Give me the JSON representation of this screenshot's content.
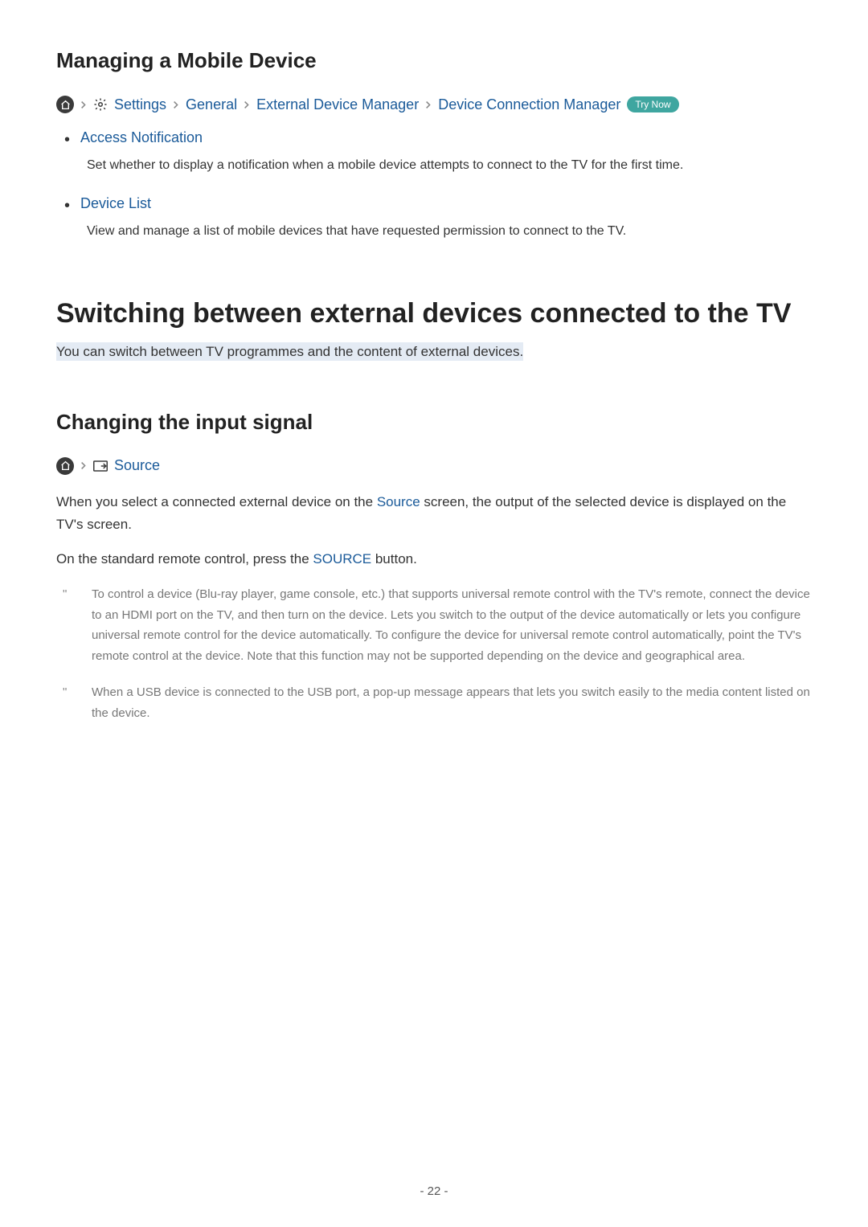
{
  "section1": {
    "title": "Managing a Mobile Device",
    "breadcrumb": {
      "settings": "Settings",
      "general": "General",
      "edm": "External Device Manager",
      "dcm": "Device Connection Manager",
      "tryNow": "Try Now"
    },
    "bullets": [
      {
        "title": "Access Notification",
        "desc": "Set whether to display a notification when a mobile device attempts to connect to the TV for the first time."
      },
      {
        "title": "Device List",
        "desc": "View and manage a list of mobile devices that have requested permission to connect to the TV."
      }
    ]
  },
  "main": {
    "title": "Switching between external devices connected to the TV",
    "intro": "You can switch between TV programmes and the content of external devices."
  },
  "section2": {
    "title": "Changing the input signal",
    "breadcrumb": {
      "source": "Source"
    },
    "p1a": "When you select a connected external device on the ",
    "p1link": "Source",
    "p1b": " screen, the output of the selected device is displayed on the TV's screen.",
    "p2a": "On the standard remote control, press the ",
    "p2link": "SOURCE",
    "p2b": " button.",
    "notes": [
      "To control a device (Blu-ray player, game console, etc.) that supports universal remote control with the TV's remote, connect the device to an HDMI port on the TV, and then turn on the device. Lets you switch to the output of the device automatically or lets you configure universal remote control for the device automatically. To configure the device for universal remote control automatically, point the TV's remote control at the device. Note that this function may not be supported depending on the device and geographical area.",
      "When a USB device is connected to the USB port, a pop-up message appears that lets you switch easily to the media content listed on the device."
    ]
  },
  "pageNumber": "- 22 -"
}
